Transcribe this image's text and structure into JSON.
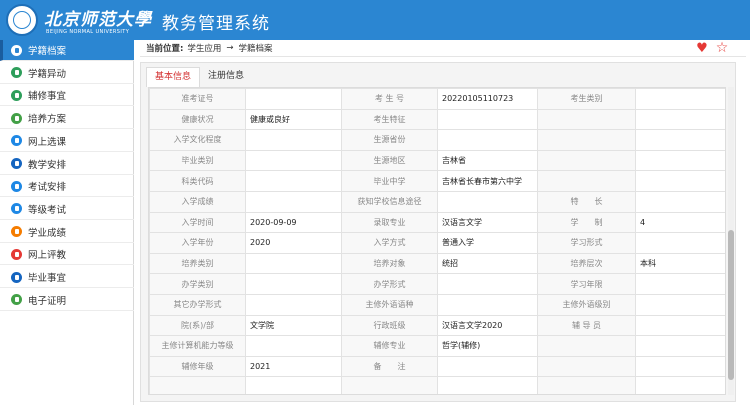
{
  "header": {
    "logo_text": "北京师范大學",
    "logo_sub": "BEIJING NORMAL UNIVERSITY",
    "app_title": "教务管理系统",
    "color": "#2b86d2"
  },
  "sidebar": {
    "items": [
      {
        "label": "学籍档案",
        "icon": "student-record-icon",
        "color": "#2b86d2",
        "active": true
      },
      {
        "label": "学籍异动",
        "icon": "status-change-icon",
        "color": "#2e9e5b",
        "active": false
      },
      {
        "label": "辅修事宜",
        "icon": "minor-study-icon",
        "color": "#2e9e5b",
        "active": false
      },
      {
        "label": "培养方案",
        "icon": "training-plan-icon",
        "color": "#43a047",
        "active": false
      },
      {
        "label": "网上选课",
        "icon": "course-selection-icon",
        "color": "#1e88e5",
        "active": false
      },
      {
        "label": "教学安排",
        "icon": "teaching-schedule-icon",
        "color": "#1565c0",
        "active": false
      },
      {
        "label": "考试安排",
        "icon": "exam-schedule-icon",
        "color": "#1e88e5",
        "active": false
      },
      {
        "label": "等级考试",
        "icon": "level-exam-icon",
        "color": "#1e88e5",
        "active": false
      },
      {
        "label": "学业成绩",
        "icon": "grades-icon",
        "color": "#f57c00",
        "active": false
      },
      {
        "label": "网上评教",
        "icon": "teaching-evaluation-icon",
        "color": "#e53935",
        "active": false
      },
      {
        "label": "毕业事宜",
        "icon": "graduation-icon",
        "color": "#1565c0",
        "active": false
      },
      {
        "label": "电子证明",
        "icon": "e-certificate-icon",
        "color": "#43a047",
        "active": false
      }
    ]
  },
  "breadcrumb": {
    "prefix": "当前位置:",
    "section": "学生应用",
    "arrow": "→",
    "page": "学籍档案"
  },
  "tabs": [
    {
      "label": "基本信息",
      "active": true
    },
    {
      "label": "注册信息",
      "active": false
    }
  ],
  "grid": {
    "rows": [
      [
        {
          "t": "label",
          "v": "准考证号"
        },
        {
          "t": "value",
          "v": ""
        },
        {
          "t": "label",
          "v": "考 生 号"
        },
        {
          "t": "value",
          "v": "20220105110723"
        },
        {
          "t": "label",
          "v": "考生类别"
        },
        {
          "t": "value",
          "v": ""
        }
      ],
      [
        {
          "t": "label",
          "v": "健康状况"
        },
        {
          "t": "value",
          "v": "健康或良好"
        },
        {
          "t": "label",
          "v": "考生特征"
        },
        {
          "t": "value",
          "v": ""
        },
        {
          "t": "label",
          "v": ""
        },
        {
          "t": "value",
          "v": ""
        }
      ],
      [
        {
          "t": "label",
          "v": "入学文化程度"
        },
        {
          "t": "value",
          "v": ""
        },
        {
          "t": "label",
          "v": "生源省份"
        },
        {
          "t": "value",
          "v": ""
        },
        {
          "t": "label",
          "v": ""
        },
        {
          "t": "value",
          "v": ""
        }
      ],
      [
        {
          "t": "label",
          "v": "毕业类别"
        },
        {
          "t": "value",
          "v": ""
        },
        {
          "t": "label",
          "v": "生源地区"
        },
        {
          "t": "value",
          "v": "吉林省"
        },
        {
          "t": "label",
          "v": ""
        },
        {
          "t": "value",
          "v": ""
        }
      ],
      [
        {
          "t": "label",
          "v": "科类代码"
        },
        {
          "t": "value",
          "v": ""
        },
        {
          "t": "label",
          "v": "毕业中学"
        },
        {
          "t": "value",
          "v": "吉林省长春市第六中学"
        },
        {
          "t": "label",
          "v": ""
        },
        {
          "t": "value",
          "v": ""
        }
      ],
      [
        {
          "t": "label",
          "v": "入学成绩"
        },
        {
          "t": "value",
          "v": ""
        },
        {
          "t": "label",
          "v": "获知学校信息途径"
        },
        {
          "t": "value",
          "v": ""
        },
        {
          "t": "label",
          "v": "特　　长"
        },
        {
          "t": "value",
          "v": ""
        }
      ],
      [
        {
          "t": "label",
          "v": "入学时间"
        },
        {
          "t": "value",
          "v": "2020-09-09"
        },
        {
          "t": "label",
          "v": "录取专业"
        },
        {
          "t": "value",
          "v": "汉语言文学"
        },
        {
          "t": "label",
          "v": "学　　制"
        },
        {
          "t": "value",
          "v": "4"
        }
      ],
      [
        {
          "t": "label",
          "v": "入学年份"
        },
        {
          "t": "value",
          "v": "2020"
        },
        {
          "t": "label",
          "v": "入学方式"
        },
        {
          "t": "value",
          "v": "普通入学"
        },
        {
          "t": "label",
          "v": "学习形式"
        },
        {
          "t": "value",
          "v": ""
        }
      ],
      [
        {
          "t": "label",
          "v": "培养类别"
        },
        {
          "t": "value",
          "v": ""
        },
        {
          "t": "label",
          "v": "培养对象"
        },
        {
          "t": "value",
          "v": "统招"
        },
        {
          "t": "label",
          "v": "培养层次"
        },
        {
          "t": "value",
          "v": "本科"
        }
      ],
      [
        {
          "t": "label",
          "v": "办学类别"
        },
        {
          "t": "value",
          "v": ""
        },
        {
          "t": "label",
          "v": "办学形式"
        },
        {
          "t": "value",
          "v": ""
        },
        {
          "t": "label",
          "v": "学习年限"
        },
        {
          "t": "value",
          "v": ""
        }
      ],
      [
        {
          "t": "label",
          "v": "其它办学形式"
        },
        {
          "t": "value",
          "v": ""
        },
        {
          "t": "label",
          "v": "主修外语语种"
        },
        {
          "t": "value",
          "v": ""
        },
        {
          "t": "label",
          "v": "主修外语级别"
        },
        {
          "t": "value",
          "v": ""
        }
      ],
      [
        {
          "t": "label",
          "v": "院(系)/部"
        },
        {
          "t": "value",
          "v": "文学院"
        },
        {
          "t": "label",
          "v": "行政班级"
        },
        {
          "t": "value",
          "v": "汉语言文学2020"
        },
        {
          "t": "label",
          "v": "辅 导 员"
        },
        {
          "t": "value",
          "v": ""
        }
      ],
      [
        {
          "t": "label",
          "v": "主修计算机能力等级"
        },
        {
          "t": "value",
          "v": ""
        },
        {
          "t": "label",
          "v": "辅修专业"
        },
        {
          "t": "value",
          "v": "哲学(辅修)"
        },
        {
          "t": "label",
          "v": ""
        },
        {
          "t": "value",
          "v": ""
        }
      ],
      [
        {
          "t": "label",
          "v": "辅修年级"
        },
        {
          "t": "value",
          "v": "2021"
        },
        {
          "t": "label",
          "v": "备　　注"
        },
        {
          "t": "value",
          "v": ""
        },
        {
          "t": "label",
          "v": ""
        },
        {
          "t": "value",
          "v": ""
        }
      ],
      [
        {
          "t": "label",
          "v": ""
        },
        {
          "t": "value",
          "v": ""
        },
        {
          "t": "label",
          "v": ""
        },
        {
          "t": "value",
          "v": ""
        },
        {
          "t": "label",
          "v": ""
        },
        {
          "t": "value",
          "v": ""
        }
      ]
    ]
  }
}
